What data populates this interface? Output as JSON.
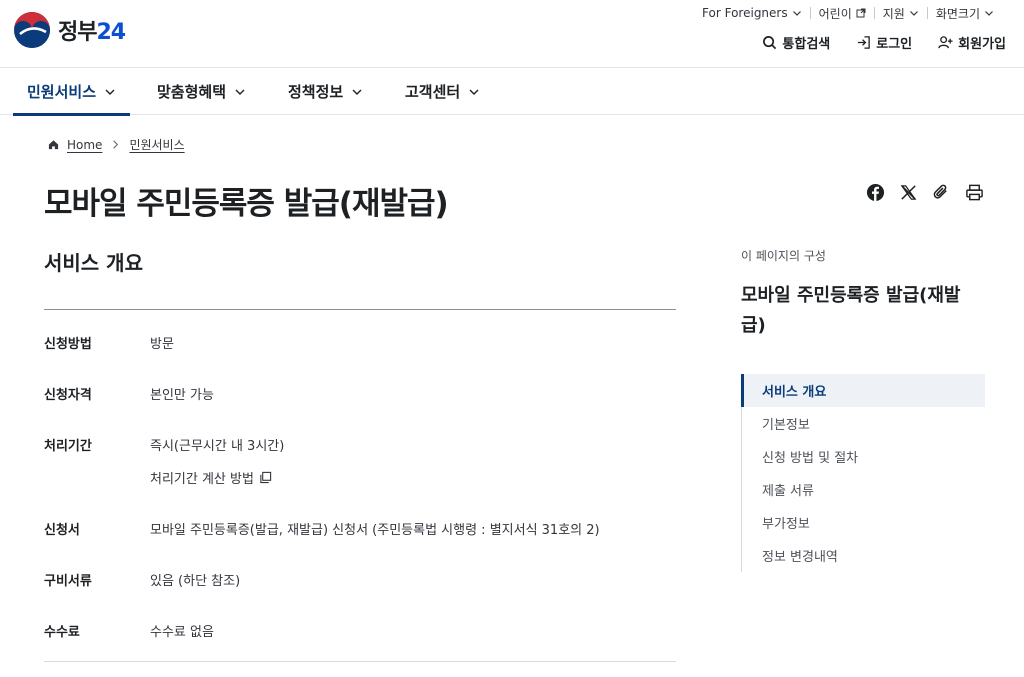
{
  "header": {
    "logo_text": "정부",
    "logo_num": "24",
    "util": [
      {
        "label": "For Foreigners",
        "icon": "chevron-down-icon"
      },
      {
        "label": "어린이",
        "icon": "external-link-icon"
      },
      {
        "label": "지원",
        "icon": "chevron-down-icon"
      },
      {
        "label": "화면크기",
        "icon": "chevron-down-icon"
      }
    ],
    "actions": {
      "search": "통합검색",
      "login": "로그인",
      "signup": "회원가입"
    }
  },
  "gnb": [
    {
      "label": "민원서비스"
    },
    {
      "label": "맞춤형혜택"
    },
    {
      "label": "정책정보"
    },
    {
      "label": "고객센터"
    }
  ],
  "breadcrumb": {
    "home": "Home",
    "current": "민원서비스"
  },
  "page": {
    "title": "모바일 주민등록증 발급(재발급)",
    "section_title": "서비스 개요"
  },
  "info": {
    "method": {
      "label": "신청방법",
      "value": "방문"
    },
    "eligibility": {
      "label": "신청자격",
      "value": "본인만 가능"
    },
    "period": {
      "label": "처리기간",
      "value": "즉시(근무시간 내 3시간)",
      "sub": "처리기간 계산 방법"
    },
    "form": {
      "label": "신청서",
      "value": "모바일 주민등록증(발급, 재발급) 신청서 (주민등록법 시행령 : 별지서식 31호의 2)"
    },
    "docs": {
      "label": "구비서류",
      "value": "있음 (하단 참조)"
    },
    "fee": {
      "label": "수수료",
      "value": "수수료 없음"
    }
  },
  "toc": {
    "caption": "이 페이지의 구성",
    "title": "모바일 주민등록증 발급(재발급)",
    "items": [
      {
        "label": "서비스 개요"
      },
      {
        "label": "기본정보"
      },
      {
        "label": "신청 방법 및 절차"
      },
      {
        "label": "제출 서류"
      },
      {
        "label": "부가정보"
      },
      {
        "label": "정보 변경내역"
      }
    ]
  },
  "colors": {
    "primary": "#0b3b7a",
    "brand_blue": "#0b50d0",
    "brand_red": "#cd2e3a"
  }
}
